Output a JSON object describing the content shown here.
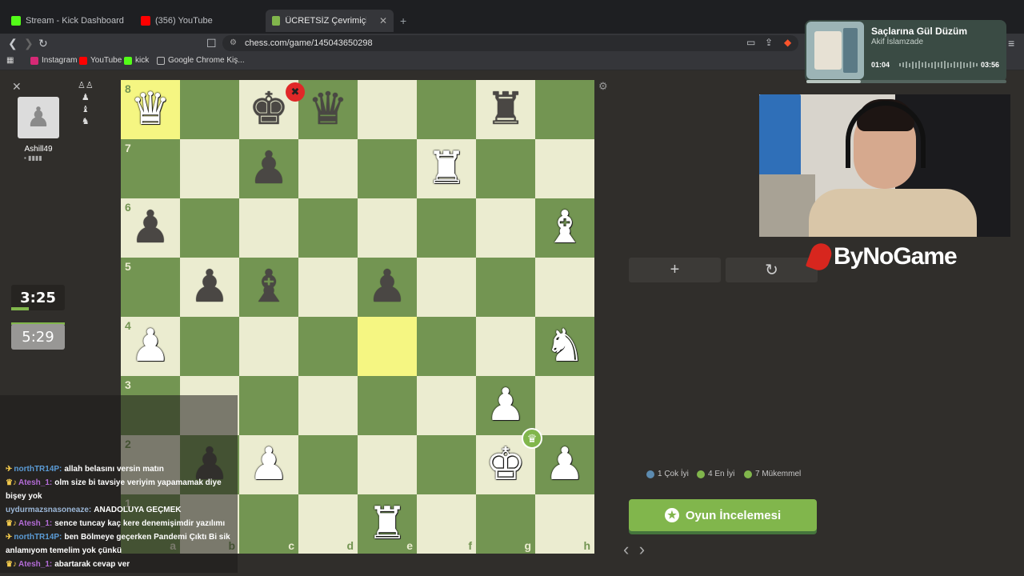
{
  "browser": {
    "tabs": [
      {
        "label": "Stream - Kick Dashboard",
        "color": "#53fc18"
      },
      {
        "label": "(356) YouTube",
        "color": "#ff0000"
      },
      {
        "label": "ÜCRETSİZ Çevrimiçi Satranç Oyn",
        "color": "#81b64c"
      }
    ],
    "new_tab": "+",
    "url": "chess.com/game/145043650298",
    "bookmarks": [
      {
        "label": "Instagram",
        "color": "#d62976"
      },
      {
        "label": "YouTube",
        "color": "#ff0000"
      },
      {
        "label": "kick",
        "color": "#53fc18"
      },
      {
        "label": "Google Chrome Kiş...",
        "color": "#555"
      }
    ]
  },
  "player": {
    "name": "Ashill49",
    "flag": "▪ ▮▮▮▮"
  },
  "clocks": {
    "top": "3:25",
    "bottom": "5:29"
  },
  "board": {
    "ranks": [
      "8",
      "7",
      "6",
      "5",
      "4",
      "3",
      "2",
      "1"
    ],
    "files": [
      "a",
      "b",
      "c",
      "d",
      "e",
      "f",
      "g",
      "h"
    ],
    "highlight": [
      "a8",
      "e4"
    ],
    "pieces": [
      {
        "sq": "a8",
        "glyph": "♛",
        "side": "w"
      },
      {
        "sq": "c8",
        "glyph": "♚",
        "side": "b"
      },
      {
        "sq": "d8",
        "glyph": "♛",
        "side": "b"
      },
      {
        "sq": "g8",
        "glyph": "♜",
        "side": "b"
      },
      {
        "sq": "c7",
        "glyph": "♟",
        "side": "b"
      },
      {
        "sq": "f7",
        "glyph": "♜",
        "side": "w"
      },
      {
        "sq": "a6",
        "glyph": "♟",
        "side": "b"
      },
      {
        "sq": "h6",
        "glyph": "♝",
        "side": "w"
      },
      {
        "sq": "b5",
        "glyph": "♟",
        "side": "b"
      },
      {
        "sq": "c5",
        "glyph": "♝",
        "side": "b"
      },
      {
        "sq": "e5",
        "glyph": "♟",
        "side": "b"
      },
      {
        "sq": "a4",
        "glyph": "♟",
        "side": "w"
      },
      {
        "sq": "h4",
        "glyph": "♞",
        "side": "w"
      },
      {
        "sq": "g3",
        "glyph": "♟",
        "side": "w"
      },
      {
        "sq": "b2",
        "glyph": "♟",
        "side": "b"
      },
      {
        "sq": "c2",
        "glyph": "♟",
        "side": "w"
      },
      {
        "sq": "g2",
        "glyph": "♚",
        "side": "w"
      },
      {
        "sq": "h2",
        "glyph": "♟",
        "side": "w"
      },
      {
        "sq": "e1",
        "glyph": "♜",
        "side": "w"
      }
    ]
  },
  "right_panel": {
    "add_label": "+",
    "reset_label": "↻",
    "stats": [
      {
        "label": "1 Çok İyi",
        "color": "#5c8bb0"
      },
      {
        "label": "4 En İyi",
        "color": "#81b64c"
      },
      {
        "label": "7 Mükemmel",
        "color": "#81b64c"
      }
    ],
    "review_label": "Oyun İncelemesi",
    "nav_prev": "‹",
    "nav_next": "›"
  },
  "sponsor": "ByNoGame",
  "music": {
    "title": "Saçlarına Gül Düzüm",
    "artist": "Akif İslamzade",
    "elapsed": "01:04",
    "total": "03:56",
    "progress": 0.27
  },
  "chat": [
    {
      "user": "northTR14P:",
      "user_color": "#5b9bd5",
      "badge": "✈",
      "text": "allah belasını versin matın"
    },
    {
      "user": "Atesh_1:",
      "user_color": "#b36bd6",
      "badge": "♛♪",
      "text": "olm size bi tavsiye veriyim yapamamak diye bişey yok"
    },
    {
      "user": "uydurmazsnasoneaze:",
      "user_color": "#9bb6d6",
      "badge": "",
      "text": "ANADOLUYA GEÇMEK"
    },
    {
      "user": "Atesh_1:",
      "user_color": "#b36bd6",
      "badge": "♛♪",
      "text": "sence tuncay kaç kere denemişimdir yazılımı"
    },
    {
      "user": "northTR14P:",
      "user_color": "#5b9bd5",
      "badge": "✈",
      "text": "ben Bölmeye geçerken Pandemi Çıktı Bi sik anlamıyom temelim yok çünkü"
    },
    {
      "user": "Atesh_1:",
      "user_color": "#b36bd6",
      "badge": "♛♪",
      "text": "abartarak cevap ver"
    }
  ]
}
